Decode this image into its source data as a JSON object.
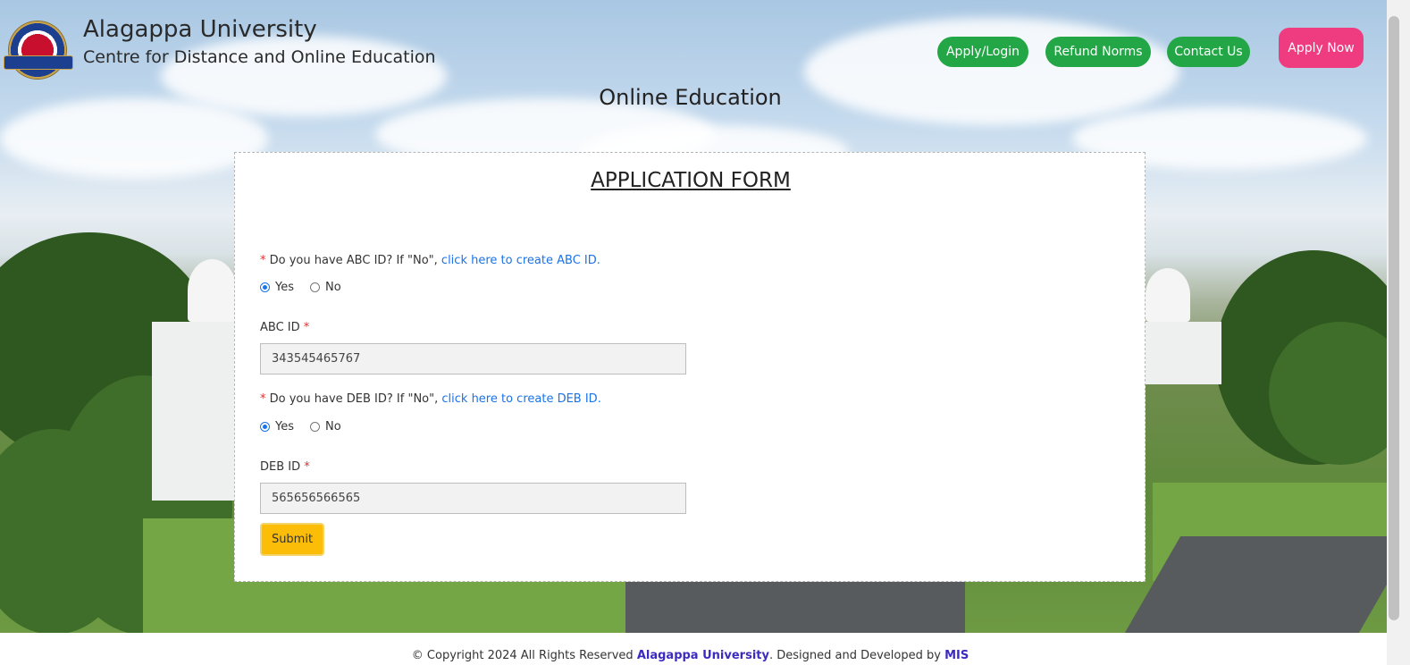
{
  "header": {
    "university": "Alagappa University",
    "centre": "Centre for Distance and Online Education",
    "logo_icon": "university-emblem-icon"
  },
  "nav": {
    "apply_login": "Apply/Login",
    "refund_norms": "Refund Norms",
    "contact_us": "Contact Us",
    "apply_now": "Apply Now"
  },
  "page_heading": "Online Education",
  "form": {
    "title": "APPLICATION FORM",
    "abc_question": {
      "required_mark": "*",
      "text": "Do you have ABC ID? If \"No\",",
      "link": "click here to create ABC ID.",
      "options": [
        "Yes",
        "No"
      ],
      "selected": "Yes"
    },
    "abc_id": {
      "label": "ABC ID",
      "required_mark": "*",
      "value": "343545465767"
    },
    "deb_question": {
      "required_mark": "*",
      "text": "Do you have DEB ID? If \"No\",",
      "link": "click here to create DEB ID.",
      "options": [
        "Yes",
        "No"
      ],
      "selected": "Yes"
    },
    "deb_id": {
      "label": "DEB ID",
      "required_mark": "*",
      "value": "565656566565"
    },
    "submit_label": "Submit"
  },
  "footer": {
    "prefix": "© Copyright 2024 All Rights Reserved",
    "org": "Alagappa University",
    "middle": ". Designed and Developed by",
    "dev": "MIS"
  },
  "colors": {
    "nav_green": "#23a645",
    "apply_now_pink": "#ef3b7f",
    "submit_yellow": "#fbbd08",
    "link_blue": "#1a73e8",
    "required_red": "#e03131",
    "footer_accent": "#3b2bbf"
  }
}
